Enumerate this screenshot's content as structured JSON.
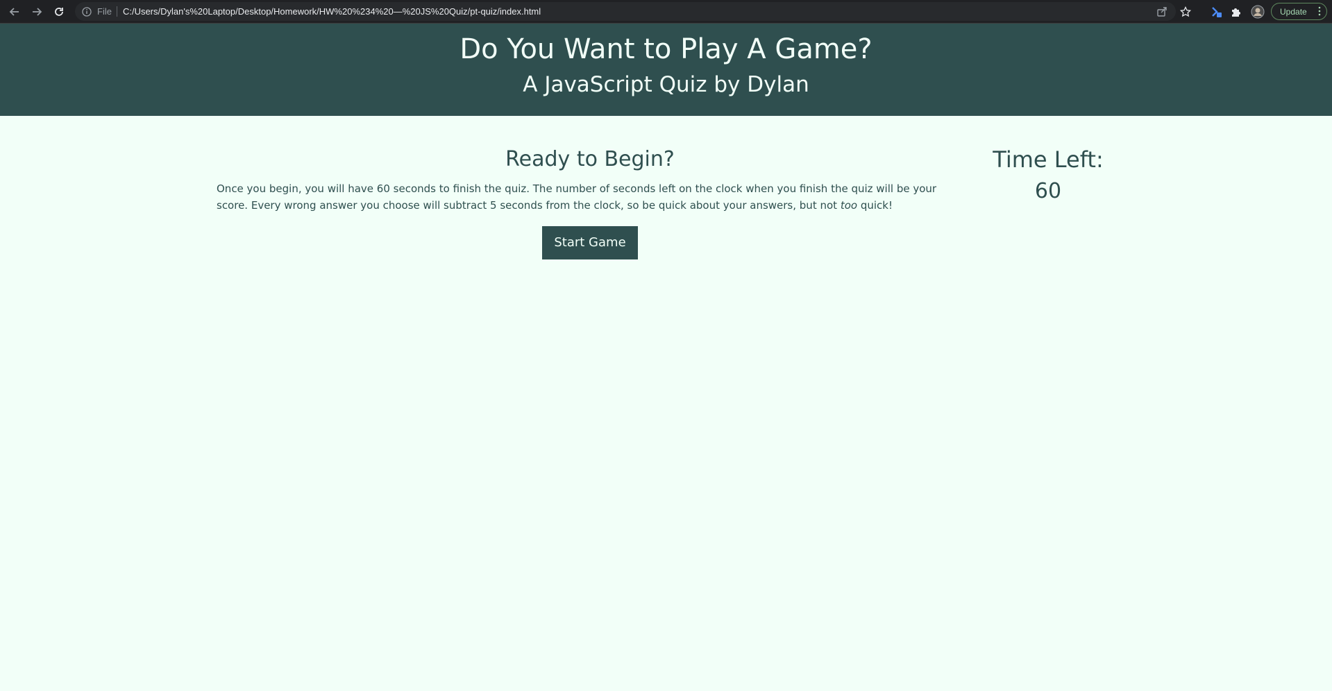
{
  "browser": {
    "scheme": "File",
    "url": "C:/Users/Dylan's%20Laptop/Desktop/Homework/HW%20%234%20—%20JS%20Quiz/pt-quiz/index.html",
    "update_label": "Update",
    "icons": [
      "back-icon",
      "forward-icon",
      "reload-icon",
      "info-icon",
      "share-icon",
      "star-icon",
      "extension-icon",
      "puzzle-icon",
      "profile-icon",
      "menu-icon"
    ]
  },
  "header": {
    "title": "Do You Want to Play A Game?",
    "subtitle": "A JavaScript Quiz by Dylan"
  },
  "quiz": {
    "heading": "Ready to Begin?",
    "intro_before": "Once you begin, you will have 60 seconds to finish the quiz. The number of seconds left on the clock when you finish the quiz will be your score. Every wrong answer you choose will subtract 5 seconds from the clock, so be quick about your answers, but not ",
    "intro_emphasis": "too",
    "intro_after": " quick!",
    "start_label": "Start Game"
  },
  "timer": {
    "label": "Time Left:",
    "value": "60"
  },
  "colors": {
    "header_bg": "#2f4f4f",
    "page_bg": "#f2fff8",
    "text": "#2f4f4f"
  }
}
